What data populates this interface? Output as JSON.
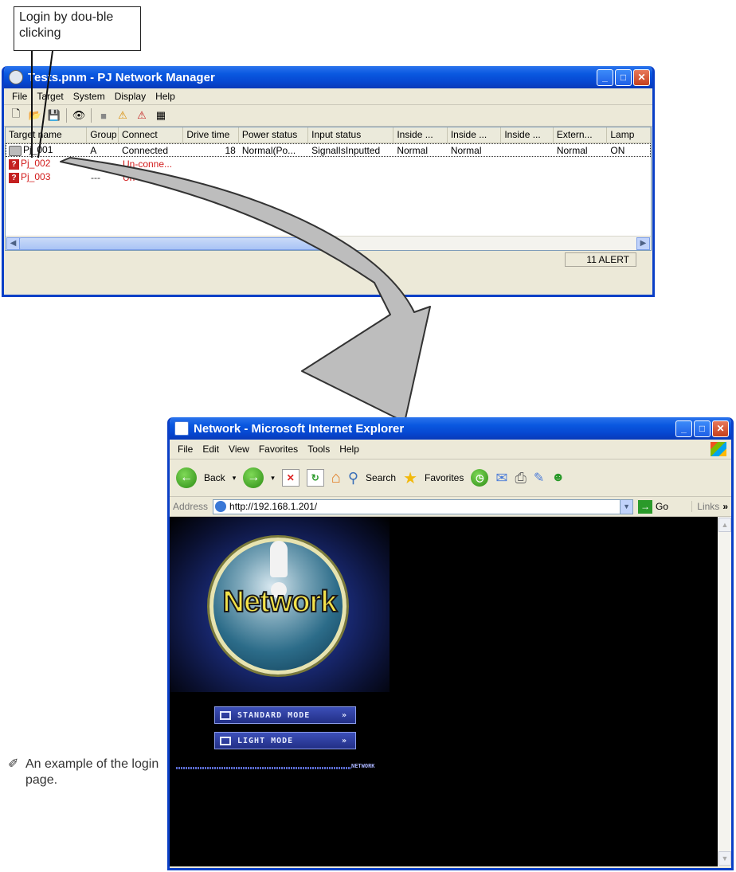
{
  "callout": {
    "text": "Login by dou-ble clicking"
  },
  "pj_window": {
    "title": "Tests.pnm - PJ Network Manager",
    "menu": [
      "File",
      "Target",
      "System",
      "Display",
      "Help"
    ],
    "columns": [
      "Target name",
      "Group",
      "Connect",
      "Drive time",
      "Power status",
      "Input status",
      "Inside ...",
      "Inside ...",
      "Inside ...",
      "Extern...",
      "Lamp"
    ],
    "rows": [
      {
        "name": "Pj_001",
        "group": "A",
        "connect": "Connected",
        "drive_time": "18",
        "power": "Normal(Po...",
        "input": "SignalIsInputted",
        "inside1": "Normal",
        "inside2": "Normal",
        "inside3": "",
        "extern": "Normal",
        "lamp": "ON",
        "status": "ok"
      },
      {
        "name": "Pj_002",
        "group": "",
        "connect": "Un-conne...",
        "status": "error"
      },
      {
        "name": "Pj_003",
        "group": "---",
        "connect": "Un-conne...",
        "status": "error"
      }
    ],
    "status_bar": "11 ALERT"
  },
  "ie_window": {
    "title": "Network - Microsoft Internet Explorer",
    "menu": [
      "File",
      "Edit",
      "View",
      "Favorites",
      "Tools",
      "Help"
    ],
    "toolbar": {
      "back": "Back",
      "search": "Search",
      "favorites": "Favorites"
    },
    "address_label": "Address",
    "address_url": "http://192.168.1.201/",
    "go_label": "Go",
    "links_label": "Links",
    "page": {
      "logo_text": "Network",
      "standard_mode": "STANDARD MODE",
      "light_mode": "LIGHT MODE",
      "divider_label": "NETWORK"
    }
  },
  "note": "An example of the login page."
}
